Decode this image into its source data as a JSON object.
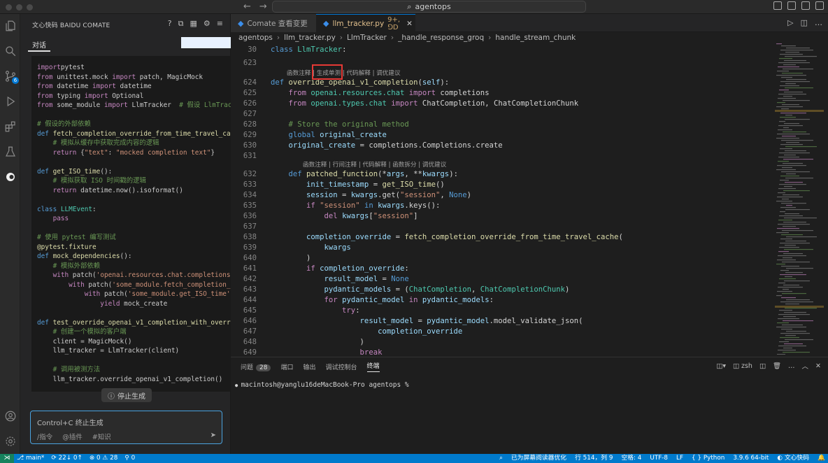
{
  "window": {
    "command_center": "agentops"
  },
  "sidebar": {
    "title": "文心快码 BAIDU COMATE",
    "tab": "对话",
    "stop_label": "停止生成",
    "input_placeholder": "Control+C 终止生成",
    "chips": [
      "/指令",
      "@插件",
      "#知识"
    ],
    "chat_code": [
      [
        [
          "c-kw2",
          "import"
        ],
        [
          "",
          "pytest"
        ]
      ],
      [
        [
          "c-kw2",
          "from"
        ],
        [
          "",
          " unittest.mock "
        ],
        [
          "c-kw2",
          "import"
        ],
        [
          "",
          " patch, MagicMock"
        ]
      ],
      [
        [
          "c-kw2",
          "from"
        ],
        [
          "",
          " datetime "
        ],
        [
          "c-kw2",
          "import"
        ],
        [
          "",
          " datetime"
        ]
      ],
      [
        [
          "c-kw2",
          "from"
        ],
        [
          "",
          " typing "
        ],
        [
          "c-kw2",
          "import"
        ],
        [
          "",
          " Optional"
        ]
      ],
      [
        [
          "c-kw2",
          "from"
        ],
        [
          "",
          " some_module "
        ],
        [
          "c-kw2",
          "import"
        ],
        [
          "",
          " LlmTracker  "
        ],
        [
          "c-com",
          "# 假设 LlmTrac"
        ]
      ],
      [
        [
          "",
          ""
        ]
      ],
      [
        [
          "c-com",
          "# 假设的外部依赖"
        ]
      ],
      [
        [
          "c-kw",
          "def"
        ],
        [
          "",
          " "
        ],
        [
          "c-fn",
          "fetch_completion_override_from_time_travel_cac"
        ]
      ],
      [
        [
          "c-com",
          "    # 模拟从缓存中获取完成内容的逻辑"
        ]
      ],
      [
        [
          "c-kw2",
          "    return"
        ],
        [
          "",
          " {"
        ],
        [
          "c-str",
          "\"text\""
        ],
        [
          "",
          ": "
        ],
        [
          "c-str",
          "\"mocked completion text\""
        ],
        [
          "",
          "}"
        ]
      ],
      [
        [
          "",
          ""
        ]
      ],
      [
        [
          "c-kw",
          "def"
        ],
        [
          "",
          " "
        ],
        [
          "c-fn",
          "get_ISO_time"
        ],
        [
          "",
          "():"
        ]
      ],
      [
        [
          "c-com",
          "    # 模拟获取 ISO 时间戳的逻辑"
        ]
      ],
      [
        [
          "c-kw2",
          "    return"
        ],
        [
          "",
          " datetime.now().isoformat()"
        ]
      ],
      [
        [
          "",
          ""
        ]
      ],
      [
        [
          "c-kw",
          "class"
        ],
        [
          "",
          " "
        ],
        [
          "c-cls",
          "LLMEvent"
        ],
        [
          "",
          ":"
        ]
      ],
      [
        [
          "c-kw2",
          "    pass"
        ]
      ],
      [
        [
          "",
          ""
        ]
      ],
      [
        [
          "c-com",
          "# 使用 pytest 编写测试"
        ]
      ],
      [
        [
          "c-dec",
          "@pytest.fixture"
        ]
      ],
      [
        [
          "c-kw",
          "def"
        ],
        [
          "",
          " "
        ],
        [
          "c-fn",
          "mock_dependencies"
        ],
        [
          "",
          "():"
        ]
      ],
      [
        [
          "c-com",
          "    # 模拟外部依赖"
        ]
      ],
      [
        [
          "c-kw2",
          "    with"
        ],
        [
          "",
          " patch("
        ],
        [
          "c-str",
          "'openai.resources.chat.completions"
        ]
      ],
      [
        [
          "c-kw2",
          "        with"
        ],
        [
          "",
          " patch("
        ],
        [
          "c-str",
          "'some_module.fetch_completion_"
        ]
      ],
      [
        [
          "c-kw2",
          "            with"
        ],
        [
          "",
          " patch("
        ],
        [
          "c-str",
          "'some_module.get_ISO_time'"
        ]
      ],
      [
        [
          "c-kw2",
          "                yield"
        ],
        [
          "",
          " mock_create"
        ]
      ],
      [
        [
          "",
          ""
        ]
      ],
      [
        [
          "c-kw",
          "def"
        ],
        [
          "",
          " "
        ],
        [
          "c-fn",
          "test_override_openai_v1_completion_with_overr"
        ]
      ],
      [
        [
          "c-com",
          "    # 创建一个模拟的客户端"
        ]
      ],
      [
        [
          "",
          "    client = MagicMock()"
        ]
      ],
      [
        [
          "",
          "    llm_tracker = LlmTracker(client)"
        ]
      ],
      [
        [
          "",
          ""
        ]
      ],
      [
        [
          "c-com",
          "    # 调用被测方法"
        ]
      ],
      [
        [
          "",
          "    llm_tracker.override_openai_v1_completion()"
        ]
      ]
    ]
  },
  "tabs": [
    {
      "label": "Comate 查看变更",
      "active": false
    },
    {
      "label": "llm_tracker.py",
      "status": "9+, ⅁D",
      "active": true
    }
  ],
  "breadcrumb": [
    "agentops",
    "llm_tracker.py",
    "LlmTracker",
    "_handle_response_groq",
    "handle_stream_chunk"
  ],
  "editor": {
    "sticky": {
      "num": "30",
      "code": [
        [
          "c-kw",
          "class"
        ],
        [
          "",
          " "
        ],
        [
          "c-cls",
          "LlmTracker"
        ],
        [
          "",
          ":"
        ]
      ]
    },
    "codelens1": "函数注释 | 生成单测 | 代码解释 | 调优建议",
    "codelens2": "函数注释 | 行间注释 | 代码解释 | 函数拆分 | 调优建议",
    "lines": [
      {
        "n": "623",
        "code": [
          [
            "",
            ""
          ]
        ]
      },
      {
        "n": "624",
        "code": [
          [
            "c-kw",
            "def"
          ],
          [
            "",
            " "
          ],
          [
            "c-fn",
            "override_openai_v1_completion"
          ],
          [
            "",
            "("
          ],
          [
            "c-var",
            "self"
          ],
          [
            "",
            "):"
          ]
        ]
      },
      {
        "n": "625",
        "code": [
          [
            "c-kw2",
            "    from"
          ],
          [
            "",
            " "
          ],
          [
            "c-cls",
            "openai.resources.chat"
          ],
          [
            "",
            " "
          ],
          [
            "c-kw2",
            "import"
          ],
          [
            "",
            " completions"
          ]
        ]
      },
      {
        "n": "626",
        "code": [
          [
            "c-kw2",
            "    from"
          ],
          [
            "",
            " "
          ],
          [
            "c-cls",
            "openai.types.chat"
          ],
          [
            "",
            " "
          ],
          [
            "c-kw2",
            "import"
          ],
          [
            "",
            " ChatCompletion, ChatCompletionChunk"
          ]
        ]
      },
      {
        "n": "627",
        "code": [
          [
            "",
            ""
          ]
        ]
      },
      {
        "n": "628",
        "code": [
          [
            "c-com",
            "    # Store the original method"
          ]
        ]
      },
      {
        "n": "629",
        "code": [
          [
            "c-kw",
            "    global"
          ],
          [
            "",
            " "
          ],
          [
            "c-var",
            "original_create"
          ]
        ]
      },
      {
        "n": "630",
        "code": [
          [
            "c-var",
            "    original_create"
          ],
          [
            "",
            " = completions.Completions.create"
          ]
        ]
      },
      {
        "n": "631",
        "code": [
          [
            "",
            ""
          ]
        ]
      },
      {
        "n": "632",
        "code": [
          [
            "c-kw",
            "    def"
          ],
          [
            "",
            " "
          ],
          [
            "c-fn",
            "patched_function"
          ],
          [
            "",
            "(*"
          ],
          [
            "c-var",
            "args"
          ],
          [
            "",
            ", **"
          ],
          [
            "c-var",
            "kwargs"
          ],
          [
            "",
            "):"
          ]
        ]
      },
      {
        "n": "633",
        "code": [
          [
            "c-var",
            "        init_timestamp"
          ],
          [
            "",
            " = "
          ],
          [
            "c-fn",
            "get_ISO_time"
          ],
          [
            "",
            "()"
          ]
        ]
      },
      {
        "n": "634",
        "code": [
          [
            "c-var",
            "        session"
          ],
          [
            "",
            " = "
          ],
          [
            "c-var",
            "kwargs"
          ],
          [
            "",
            ".get("
          ],
          [
            "c-str",
            "\"session\""
          ],
          [
            "",
            ", "
          ],
          [
            "c-kw",
            "None"
          ],
          [
            "",
            ")"
          ]
        ]
      },
      {
        "n": "635",
        "code": [
          [
            "c-kw2",
            "        if"
          ],
          [
            "",
            " "
          ],
          [
            "c-str",
            "\"session\""
          ],
          [
            "",
            " "
          ],
          [
            "c-kw",
            "in"
          ],
          [
            "",
            " "
          ],
          [
            "c-var",
            "kwargs"
          ],
          [
            "",
            ".keys():"
          ]
        ]
      },
      {
        "n": "636",
        "code": [
          [
            "c-kw2",
            "            del"
          ],
          [
            "",
            " "
          ],
          [
            "c-var",
            "kwargs"
          ],
          [
            "",
            "["
          ],
          [
            "c-str",
            "\"session\""
          ],
          [
            "",
            "]"
          ]
        ]
      },
      {
        "n": "637",
        "code": [
          [
            "",
            ""
          ]
        ]
      },
      {
        "n": "638",
        "code": [
          [
            "c-var",
            "        completion_override"
          ],
          [
            "",
            " = "
          ],
          [
            "c-fn",
            "fetch_completion_override_from_time_travel_cache"
          ],
          [
            "",
            "("
          ]
        ]
      },
      {
        "n": "639",
        "code": [
          [
            "c-var",
            "            kwargs"
          ]
        ]
      },
      {
        "n": "640",
        "code": [
          [
            "",
            "        )"
          ]
        ]
      },
      {
        "n": "641",
        "code": [
          [
            "c-kw2",
            "        if"
          ],
          [
            "",
            " "
          ],
          [
            "c-var",
            "completion_override"
          ],
          [
            "",
            ":"
          ]
        ]
      },
      {
        "n": "642",
        "code": [
          [
            "c-var",
            "            result_model"
          ],
          [
            "",
            " = "
          ],
          [
            "c-kw",
            "None"
          ]
        ]
      },
      {
        "n": "643",
        "code": [
          [
            "c-var",
            "            pydantic_models"
          ],
          [
            "",
            " = ("
          ],
          [
            "c-cls",
            "ChatCompletion"
          ],
          [
            "",
            ", "
          ],
          [
            "c-cls",
            "ChatCompletionChunk"
          ],
          [
            "",
            ")"
          ]
        ]
      },
      {
        "n": "644",
        "code": [
          [
            "c-kw2",
            "            for"
          ],
          [
            "",
            " "
          ],
          [
            "c-var",
            "pydantic_model"
          ],
          [
            "",
            " "
          ],
          [
            "c-kw2",
            "in"
          ],
          [
            "",
            " "
          ],
          [
            "c-var",
            "pydantic_models"
          ],
          [
            "",
            ":"
          ]
        ]
      },
      {
        "n": "645",
        "code": [
          [
            "c-kw2",
            "                try"
          ],
          [
            "",
            ":"
          ]
        ]
      },
      {
        "n": "646",
        "code": [
          [
            "c-var",
            "                    result_model"
          ],
          [
            "",
            " = "
          ],
          [
            "c-var",
            "pydantic_model"
          ],
          [
            "",
            ".model_validate_json("
          ]
        ]
      },
      {
        "n": "647",
        "code": [
          [
            "c-var",
            "                        completion_override"
          ]
        ]
      },
      {
        "n": "648",
        "code": [
          [
            "",
            "                    )"
          ]
        ]
      },
      {
        "n": "649",
        "code": [
          [
            "c-kw2",
            "                    break"
          ]
        ]
      }
    ]
  },
  "panel": {
    "tabs": [
      "问题",
      "端口",
      "输出",
      "调试控制台",
      "终端"
    ],
    "problems_count": "28",
    "shell": "zsh",
    "terminal_prompt": "macintosh@yanglu16deMacBook-Pro agentops %"
  },
  "status": {
    "branch": "main*",
    "sync": "22↓ 0↑",
    "errors": "0",
    "warnings": "28",
    "ports": "0",
    "screen_reader": "已为屏幕阅读器优化",
    "position": "行 514，列 9",
    "spaces": "空格: 4",
    "encoding": "UTF-8",
    "eol": "LF",
    "language": "Python",
    "interpreter": "3.9.6 64-bit",
    "comate": "文心快码"
  },
  "colors": {
    "accent": "#007acc",
    "remote": "#16825d",
    "highlight_box": "#e53935"
  }
}
